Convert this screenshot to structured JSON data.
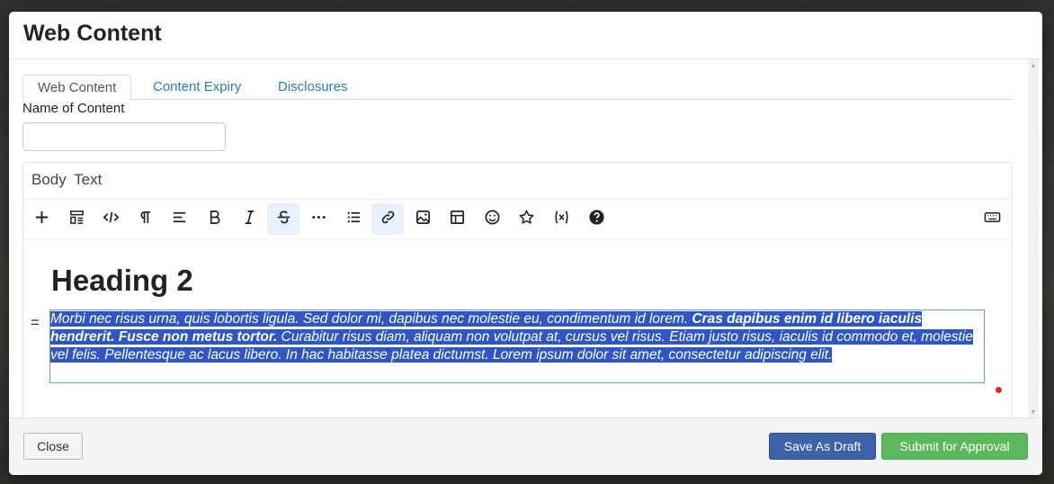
{
  "modal": {
    "title": "Web Content",
    "tabs": [
      {
        "label": "Web Content",
        "active": true
      },
      {
        "label": "Content Expiry",
        "active": false
      },
      {
        "label": "Disclosures",
        "active": false
      }
    ],
    "name_field": {
      "label": "Name of Content",
      "value": "",
      "placeholder": ""
    },
    "editor": {
      "label": "Body Text",
      "toolbar": [
        {
          "name": "add",
          "icon": "plus-icon"
        },
        {
          "name": "block-type",
          "icon": "layout-icon"
        },
        {
          "name": "code",
          "icon": "code-icon"
        },
        {
          "name": "paragraph",
          "icon": "pilcrow-icon"
        },
        {
          "name": "align",
          "icon": "align-left-icon"
        },
        {
          "name": "bold",
          "icon": "bold-icon"
        },
        {
          "name": "italic",
          "icon": "italic-icon"
        },
        {
          "name": "strikethrough",
          "icon": "strikethrough-icon",
          "active": true
        },
        {
          "name": "more",
          "icon": "ellipsis-icon"
        },
        {
          "name": "list",
          "icon": "list-icon"
        },
        {
          "name": "link",
          "icon": "link-icon",
          "active": true
        },
        {
          "name": "image",
          "icon": "image-icon"
        },
        {
          "name": "table",
          "icon": "table-icon"
        },
        {
          "name": "emoji",
          "icon": "smiley-icon"
        },
        {
          "name": "special",
          "icon": "star-icon"
        },
        {
          "name": "variable",
          "icon": "variable-icon"
        },
        {
          "name": "help",
          "icon": "help-icon"
        },
        {
          "name": "keyboard",
          "icon": "keyboard-icon"
        }
      ],
      "heading": "Heading 2",
      "paragraph": {
        "part1": "Morbi nec risus urna, quis lobortis ligula. Sed dolor mi, dapibus nec molestie eu, condimentum id lorem. ",
        "bold": "Cras dapibus enim id libero iaculis hendrerit. Fusce non metus tortor.",
        "part2": " Curabitur risus diam, aliquam non volutpat at, cursus vel risus. Etiam justo risus, iaculis id commodo et, molestie vel felis. Pellentesque ac lacus libero. In hac habitasse platea dictumst. Lorem ipsum dolor sit amet, consectetur adipiscing elit."
      }
    },
    "footer": {
      "close_label": "Close",
      "draft_label": "Save As Draft",
      "submit_label": "Submit for Approval"
    }
  },
  "colors": {
    "tab_link": "#2a7fb8",
    "selection": "#2f56c5",
    "draft_button": "#3c63a8",
    "submit_button": "#5cb85c",
    "status_dot": "#e12525"
  }
}
